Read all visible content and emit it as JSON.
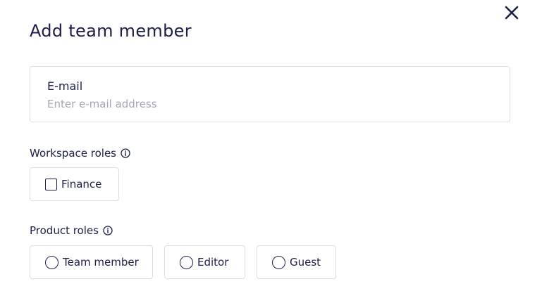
{
  "dialog": {
    "title": "Add team member",
    "close_icon": "close-icon"
  },
  "email": {
    "label": "E-mail",
    "value": "",
    "placeholder": "Enter e-mail address"
  },
  "workspace_roles": {
    "label": "Workspace roles",
    "info_icon": "info-icon",
    "options": [
      {
        "label": "Finance",
        "checked": false
      }
    ]
  },
  "product_roles": {
    "label": "Product roles",
    "info_icon": "info-icon",
    "options": [
      {
        "label": "Team member",
        "selected": false
      },
      {
        "label": "Editor",
        "selected": false
      },
      {
        "label": "Guest",
        "selected": false
      }
    ]
  },
  "colors": {
    "text": "#1c1f4a",
    "placeholder": "#a4a6b7",
    "border": "#dcdde3",
    "background": "#ffffff"
  }
}
